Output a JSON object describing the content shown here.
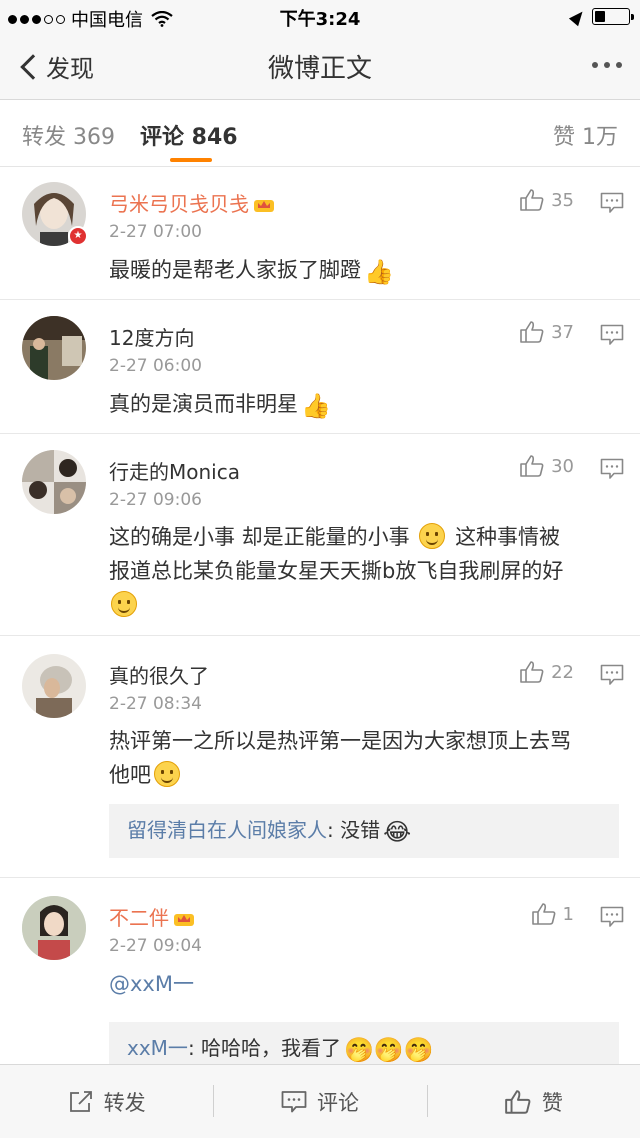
{
  "status": {
    "carrier": "中国电信",
    "time": "下午3:24"
  },
  "nav": {
    "back_label": "发现",
    "title": "微博正文"
  },
  "tabs": {
    "reposts": "转发 369",
    "comments": "评论 846",
    "likes": "赞 1万"
  },
  "comments": [
    {
      "name": "弓米弓贝戋贝戋",
      "time": "2-27 07:00",
      "text": "最暖的是帮老人家扳了脚蹬",
      "likes": "35"
    },
    {
      "name": "12度方向",
      "time": "2-27 06:00",
      "text": "真的是演员而非明星",
      "likes": "37"
    },
    {
      "name": "行走的Monica",
      "time": "2-27 09:06",
      "text_line1": "这的确是小事 却是正能量的小事",
      "text_line1b": "这种事情被",
      "text_line2": "报道总比某负能量女星天天撕b放飞自我刷屏的好",
      "likes": "30"
    },
    {
      "name": "真的很久了",
      "time": "2-27 08:34",
      "text_line1": "热评第一之所以是热评第一是因为大家想顶上去骂",
      "text_line2": "他吧",
      "likes": "22",
      "reply_name": "留得清白在人间娘家人",
      "reply_text": ": 没错"
    },
    {
      "name": "不二伴",
      "time": "2-27 09:04",
      "text": "@xxM一",
      "likes": "1",
      "reply_name": "xxM一",
      "reply_text": ": 哈哈哈，我看了"
    }
  ],
  "toolbar": {
    "repost": "转发",
    "comment": "评论",
    "like": "赞"
  },
  "colors": {
    "accent": "#ff8200",
    "vip_name": "#eb7350",
    "link": "#5b7da8"
  }
}
